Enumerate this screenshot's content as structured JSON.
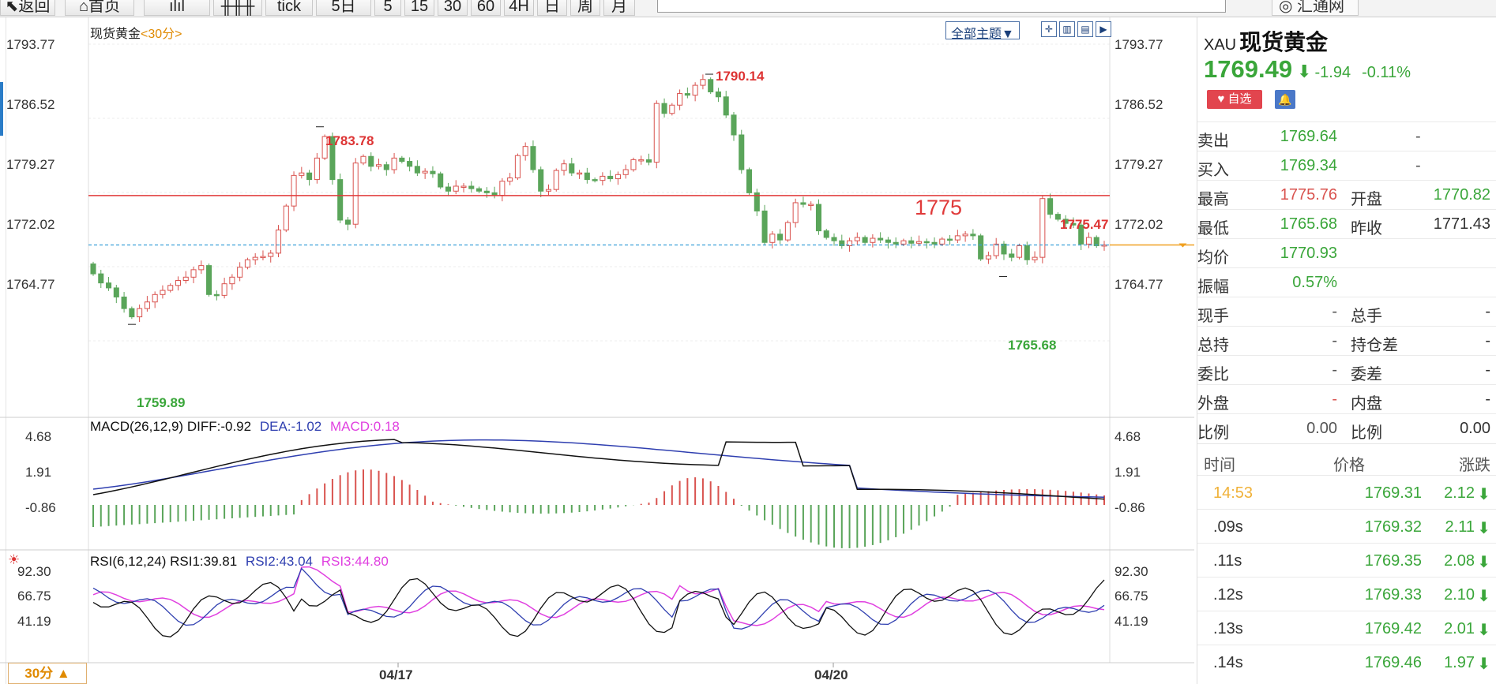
{
  "toolbar": {
    "buttons": [
      {
        "label": "返回",
        "icon": "back-arrow-icon"
      },
      {
        "label": "首页",
        "icon": "home-icon"
      },
      {
        "label": "",
        "icon": "bar-chart-icon"
      },
      {
        "label": "",
        "icon": "candlestick-icon"
      },
      {
        "label": "tick"
      },
      {
        "label": "5日"
      },
      {
        "label": "5"
      },
      {
        "label": "15"
      },
      {
        "label": "30"
      },
      {
        "label": "60"
      },
      {
        "label": "4H"
      },
      {
        "label": "日"
      },
      {
        "label": "周"
      },
      {
        "label": "月"
      }
    ],
    "brand": "汇通网"
  },
  "chart": {
    "title": "现货黄金",
    "period_tag": "<30分>",
    "theme_button": "全部主题▼",
    "period_badge": "30分 ▲",
    "price_axis": [
      "1793.77",
      "1786.52",
      "1779.27",
      "1772.02",
      "1764.77"
    ],
    "macd_axis": [
      "4.68",
      "1.91",
      "-0.86"
    ],
    "rsi_axis": [
      "92.30",
      "66.75",
      "41.19"
    ],
    "date_labels": [
      "04/17",
      "04/20"
    ],
    "annotations": {
      "high1": "1783.78",
      "high2": "1790.14",
      "low1": "1759.89",
      "low2": "1765.68",
      "hline_label": "1775",
      "hline_value": "1775.47"
    },
    "macd": {
      "label": "MACD(26,12,9)",
      "diff": "DIFF:-0.92",
      "dea": "DEA:-1.02",
      "macd": "MACD:0.18"
    },
    "rsi": {
      "label": "RSI(6,12,24)",
      "rsi1": "RSI1:39.81",
      "rsi2": "RSI2:43.04",
      "rsi3": "RSI3:44.80"
    },
    "colors": {
      "up": "#d9534f",
      "down": "#5aa55a",
      "hline": "#e03a3a",
      "dash": "#3aa0d8",
      "dea": "#2f3fb0",
      "rsi3": "#e040e0"
    }
  },
  "quote": {
    "code": "XAU",
    "name": "现货黄金",
    "price": "1769.49",
    "change": "-1.94",
    "pct": "-0.11%",
    "fav_label": "自选",
    "rows": [
      {
        "l1": "卖出",
        "v1": "1769.64",
        "l2": "",
        "v2": "",
        "mid": "-"
      },
      {
        "l1": "买入",
        "v1": "1769.34",
        "l2": "",
        "v2": "",
        "mid": "-"
      },
      {
        "l1": "最高",
        "v1": "1775.76",
        "l2": "开盘",
        "v2": "1770.82"
      },
      {
        "l1": "最低",
        "v1": "1765.68",
        "l2": "昨收",
        "v2": "1771.43"
      },
      {
        "l1": "均价",
        "v1": "1770.93",
        "l2": "",
        "v2": ""
      },
      {
        "l1": "振幅",
        "v1": "0.57%",
        "l2": "",
        "v2": ""
      },
      {
        "l1": "现手",
        "v1": "-",
        "l2": "总手",
        "v2": "-"
      },
      {
        "l1": "总持",
        "v1": "-",
        "l2": "持仓差",
        "v2": "-"
      },
      {
        "l1": "委比",
        "v1": "-",
        "l2": "委差",
        "v2": "-"
      },
      {
        "l1": "外盘",
        "v1": "-",
        "l2": "内盘",
        "v2": "-"
      },
      {
        "l1": "比例",
        "v1": "0.00",
        "l2": "比例",
        "v2": "0.00"
      }
    ],
    "ticks_header": {
      "time": "时间",
      "price": "价格",
      "change": "涨跌"
    },
    "ticks": [
      {
        "time": "14:53",
        "price": "1769.31",
        "vol": "2.12"
      },
      {
        "time": ".09s",
        "price": "1769.32",
        "vol": "2.11"
      },
      {
        "time": ".11s",
        "price": "1769.35",
        "vol": "2.08"
      },
      {
        "time": ".12s",
        "price": "1769.33",
        "vol": "2.10"
      },
      {
        "time": ".13s",
        "price": "1769.42",
        "vol": "2.01"
      },
      {
        "time": ".14s",
        "price": "1769.46",
        "vol": "1.97"
      }
    ]
  }
}
